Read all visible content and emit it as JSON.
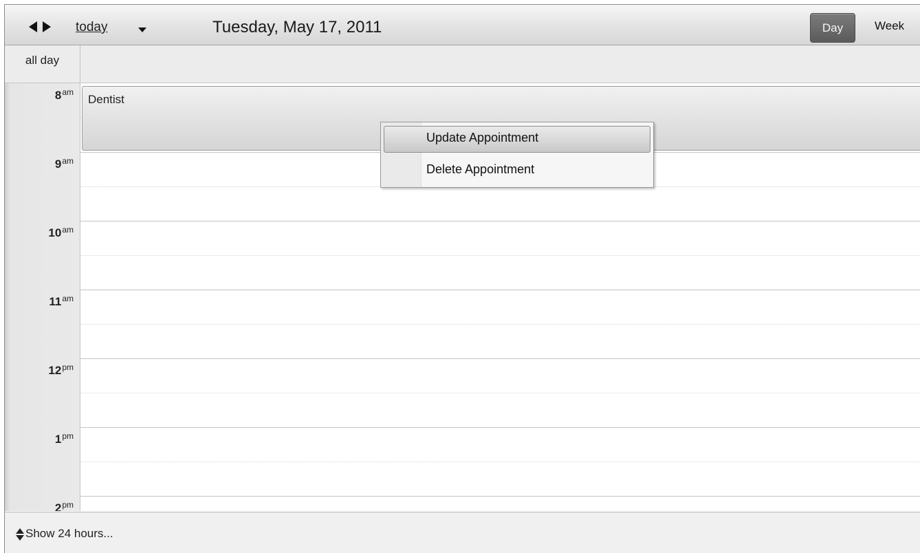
{
  "toolbar": {
    "prev_icon": "chevron-left-icon",
    "next_icon": "chevron-right-icon",
    "today_label": "today",
    "date_title": "Tuesday, May 17, 2011",
    "views": [
      {
        "label": "Day",
        "active": true
      },
      {
        "label": "Week",
        "active": false
      }
    ]
  },
  "allday": {
    "label": "all day"
  },
  "hours": [
    {
      "hour": "8",
      "suffix": "am"
    },
    {
      "hour": "9",
      "suffix": "am"
    },
    {
      "hour": "10",
      "suffix": "am"
    },
    {
      "hour": "11",
      "suffix": "am"
    },
    {
      "hour": "12",
      "suffix": "pm"
    },
    {
      "hour": "1",
      "suffix": "pm"
    },
    {
      "hour": "2",
      "suffix": "pm"
    }
  ],
  "event": {
    "title": "Dentist"
  },
  "context_menu": {
    "items": [
      {
        "label": "Update Appointment",
        "highlighted": true
      },
      {
        "label": "Delete Appointment",
        "highlighted": false
      }
    ]
  },
  "footer": {
    "show_label": "Show 24 hours...",
    "icon": "expand-icon"
  },
  "colors": {
    "active_view_bg": "#5e5e5e",
    "toolbar_bg": "#e3e3e3",
    "event_bg": "#e0e0e0"
  }
}
